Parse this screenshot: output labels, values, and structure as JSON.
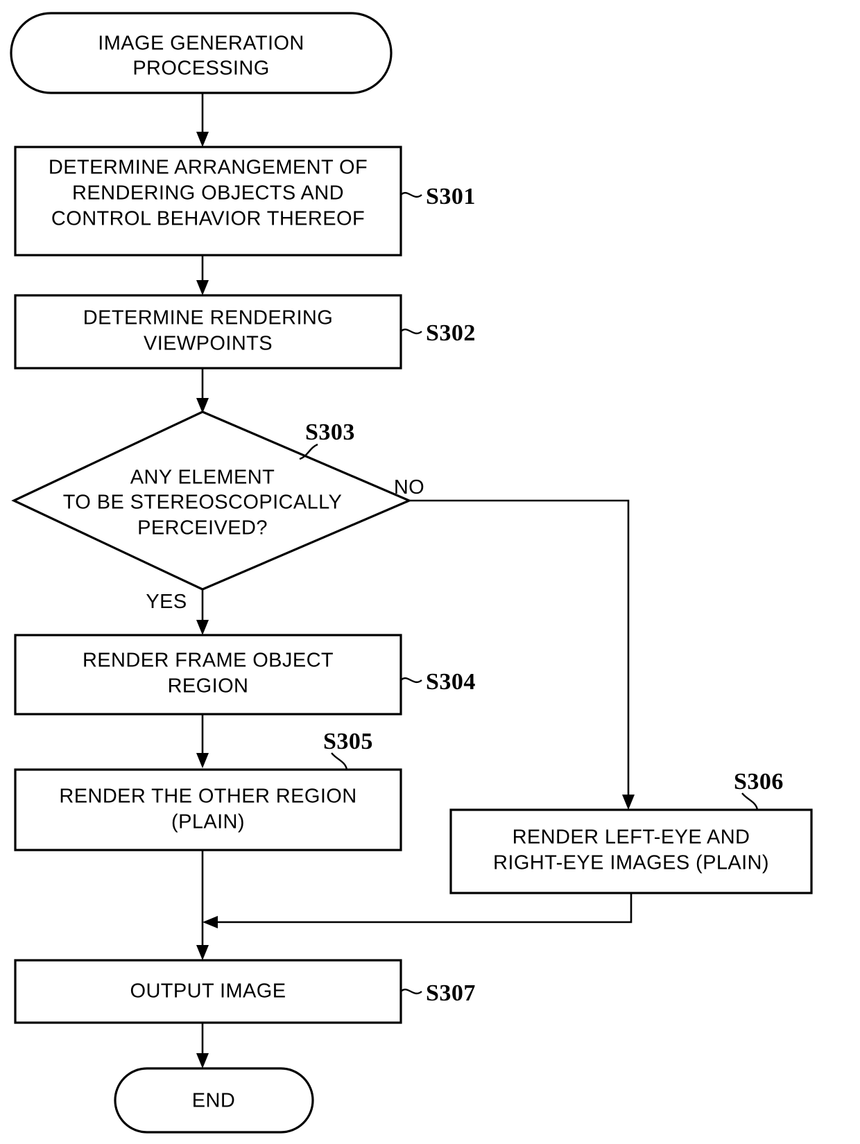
{
  "diagram": {
    "type": "flowchart",
    "title_node": "IMAGE GENERATION PROCESSING",
    "nodes": {
      "start": {
        "shape": "terminator",
        "line1": "IMAGE GENERATION",
        "line2": "PROCESSING"
      },
      "s301": {
        "shape": "process",
        "step": "S301",
        "line1": "DETERMINE ARRANGEMENT OF",
        "line2": "RENDERING OBJECTS AND",
        "line3": "CONTROL BEHAVIOR THEREOF"
      },
      "s302": {
        "shape": "process",
        "step": "S302",
        "line1": "DETERMINE RENDERING",
        "line2": "VIEWPOINTS"
      },
      "s303": {
        "shape": "decision",
        "step": "S303",
        "line1": "ANY ELEMENT",
        "line2": "TO BE STEREOSCOPICALLY",
        "line3": "PERCEIVED?",
        "yes_label": "YES",
        "no_label": "NO"
      },
      "s304": {
        "shape": "process",
        "step": "S304",
        "line1": "RENDER FRAME OBJECT",
        "line2": "REGION"
      },
      "s305": {
        "shape": "process",
        "step": "S305",
        "line1": "RENDER THE OTHER REGION",
        "line2": "(PLAIN)"
      },
      "s306": {
        "shape": "process",
        "step": "S306",
        "line1": "RENDER LEFT-EYE AND",
        "line2": "RIGHT-EYE IMAGES (PLAIN)"
      },
      "s307": {
        "shape": "process",
        "step": "S307",
        "line1": "OUTPUT IMAGE"
      },
      "end": {
        "shape": "terminator",
        "line1": "END"
      }
    },
    "colors": {
      "stroke": "#000000",
      "fill": "#ffffff",
      "text": "#000000"
    }
  }
}
